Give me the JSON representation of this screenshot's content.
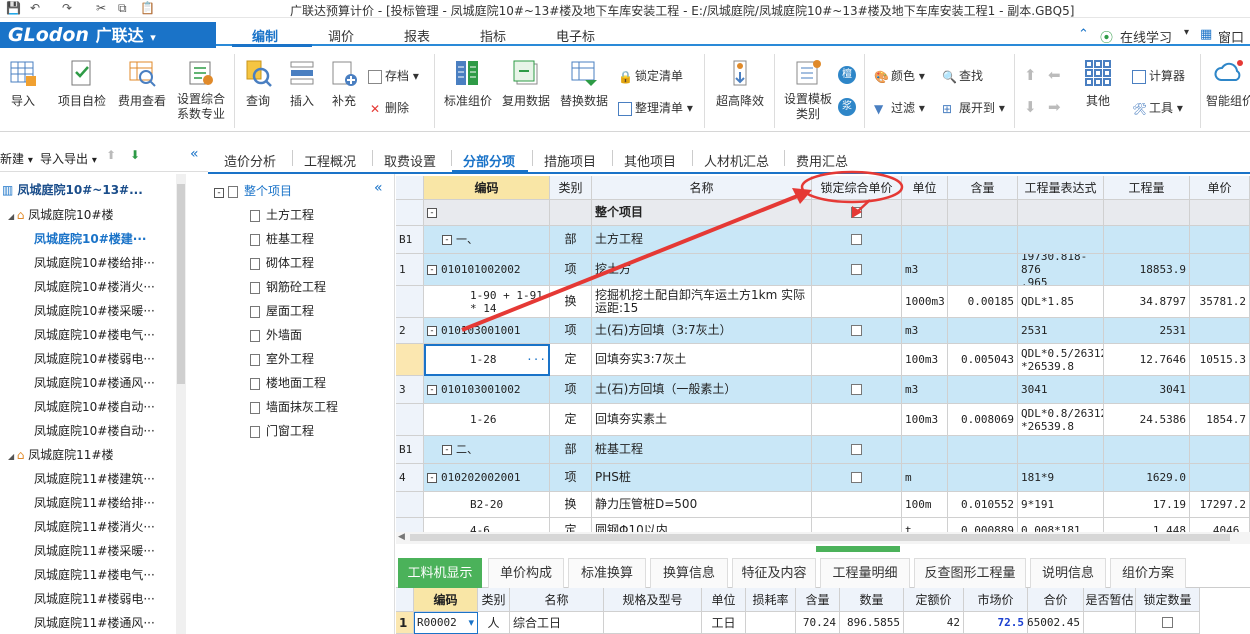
{
  "window": {
    "title": "广联达预算计价 - [投标管理 - 凤城庭院10#~13#楼及地下车库安装工程 - E:/凤城庭院/凤城庭院10#~13#楼及地下车库安装工程1 - 副本.GBQ5]"
  },
  "brand": {
    "logo": "GLodon",
    "logo_cn": "广联达",
    "dropdown": "▾"
  },
  "menu": {
    "items": [
      "编制",
      "调价",
      "报表",
      "指标",
      "电子标"
    ],
    "active": 0
  },
  "menu_right": {
    "online": "在线学习",
    "window": "窗口"
  },
  "ribbon": {
    "big": [
      "导入",
      "项目自检",
      "费用查看",
      "设置综合\n系数专业",
      "查询",
      "插入",
      "补充",
      "标准组价",
      "复用数据",
      "替换数据",
      "超高降效",
      "设置模板\n类别",
      "其他",
      "智能组价"
    ],
    "small": {
      "save": "存档",
      "delete": "删除",
      "lock_list": "锁定清单",
      "sort_list": "整理清单",
      "color": "颜色",
      "find": "查找",
      "filter": "过滤",
      "expand_to": "展开到",
      "calculator": "计算器",
      "tools": "工具"
    },
    "circle_icons": [
      "檀",
      "浆"
    ]
  },
  "left_toolbar": {
    "new": "新建",
    "import_export": "导入导出"
  },
  "left_tree": {
    "root": "凤城庭院10#~13#...",
    "items": [
      {
        "label": "凤城庭院10#楼",
        "level": 1
      },
      {
        "label": "凤城庭院10#楼建···",
        "level": 2,
        "selected": true
      },
      {
        "label": "凤城庭院10#楼给排···",
        "level": 2
      },
      {
        "label": "凤城庭院10#楼消火···",
        "level": 2
      },
      {
        "label": "凤城庭院10#楼采暖···",
        "level": 2
      },
      {
        "label": "凤城庭院10#楼电气···",
        "level": 2
      },
      {
        "label": "凤城庭院10#楼弱电···",
        "level": 2
      },
      {
        "label": "凤城庭院10#楼通风···",
        "level": 2
      },
      {
        "label": "凤城庭院10#楼自动···",
        "level": 2
      },
      {
        "label": "凤城庭院10#楼自动···",
        "level": 2
      },
      {
        "label": "凤城庭院11#楼",
        "level": 1
      },
      {
        "label": "凤城庭院11#楼建筑···",
        "level": 2
      },
      {
        "label": "凤城庭院11#楼给排···",
        "level": 2
      },
      {
        "label": "凤城庭院11#楼消火···",
        "level": 2
      },
      {
        "label": "凤城庭院11#楼采暖···",
        "level": 2
      },
      {
        "label": "凤城庭院11#楼电气···",
        "level": 2
      },
      {
        "label": "凤城庭院11#楼弱电···",
        "level": 2
      },
      {
        "label": "凤城庭院11#楼通风···",
        "level": 2
      }
    ]
  },
  "tabs": {
    "items": [
      "造价分析",
      "工程概况",
      "取费设置",
      "分部分项",
      "措施项目",
      "其他项目",
      "人材机汇总",
      "费用汇总"
    ],
    "active": 3
  },
  "section_tree": {
    "root": "整个项目",
    "items": [
      "土方工程",
      "桩基工程",
      "砌体工程",
      "钢筋砼工程",
      "屋面工程",
      "外墙面",
      "室外工程",
      "楼地面工程",
      "墙面抹灰工程",
      "门窗工程"
    ]
  },
  "grid": {
    "headers": [
      "",
      "编码",
      "类别",
      "名称",
      "锁定综合单价",
      "单位",
      "含量",
      "工程量表达式",
      "工程量",
      "单价"
    ],
    "rows": [
      {
        "no": "",
        "code": "",
        "type": "",
        "name": "整个项目",
        "unit": "",
        "content": "",
        "expr": "",
        "qty": "",
        "price": "",
        "style": "gray",
        "pm": "-",
        "chk": true
      },
      {
        "no": "B1",
        "code": "一、",
        "type": "部",
        "name": "土方工程",
        "unit": "",
        "content": "",
        "expr": "",
        "qty": "",
        "price": "",
        "style": "blue",
        "pm": "-",
        "chk": true
      },
      {
        "no": "1",
        "code": "010101002002",
        "type": "项",
        "name": "挖土方",
        "unit": "m3",
        "content": "",
        "expr": "19730.818-876\n.965",
        "qty": "18853.9",
        "price": "",
        "style": "blue",
        "pm": "-",
        "chk": true
      },
      {
        "no": "",
        "code": "1-90 + 1-91\n* 14",
        "type": "换",
        "name": "挖掘机挖土配自卸汽车运土方1km  实际\n运距:15",
        "unit": "1000m3",
        "content": "0.00185",
        "expr": "QDL*1.85",
        "qty": "34.8797",
        "price": "35781.2",
        "style": "white",
        "pm": "",
        "chk": false
      },
      {
        "no": "2",
        "code": "010103001001",
        "type": "项",
        "name": "土(石)方回填（3:7灰土）",
        "unit": "m3",
        "content": "",
        "expr": "2531",
        "qty": "2531",
        "price": "",
        "style": "blue",
        "pm": "-",
        "chk": true
      },
      {
        "no": "",
        "code": "1-28",
        "type": "定",
        "name": "回填夯实3:7灰土",
        "unit": "100m3",
        "content": "0.005043",
        "expr": "QDL*0.5/26312\n*26539.8",
        "qty": "12.7646",
        "price": "10515.3",
        "style": "white",
        "pm": "",
        "chk": false,
        "active": true
      },
      {
        "no": "3",
        "code": "010103001002",
        "type": "项",
        "name": "土(石)方回填（一般素土）",
        "unit": "m3",
        "content": "",
        "expr": "3041",
        "qty": "3041",
        "price": "",
        "style": "blue",
        "pm": "-",
        "chk": true
      },
      {
        "no": "",
        "code": "1-26",
        "type": "定",
        "name": "回填夯实素土",
        "unit": "100m3",
        "content": "0.008069",
        "expr": "QDL*0.8/26312\n*26539.8",
        "qty": "24.5386",
        "price": "1854.7",
        "style": "white",
        "pm": "",
        "chk": false
      },
      {
        "no": "B1",
        "code": "二、",
        "type": "部",
        "name": "桩基工程",
        "unit": "",
        "content": "",
        "expr": "",
        "qty": "",
        "price": "",
        "style": "blue",
        "pm": "-",
        "chk": true
      },
      {
        "no": "4",
        "code": "010202002001",
        "type": "项",
        "name": "PHS桩",
        "unit": "m",
        "content": "",
        "expr": "181*9",
        "qty": "1629.0",
        "price": "",
        "style": "blue",
        "pm": "-",
        "chk": true
      },
      {
        "no": "",
        "code": "B2-20",
        "type": "换",
        "name": "静力压管桩D=500",
        "unit": "100m",
        "content": "0.010552",
        "expr": "9*191",
        "qty": "17.19",
        "price": "17297.2",
        "style": "white",
        "pm": "",
        "chk": false
      },
      {
        "no": "",
        "code": "4-6",
        "type": "定",
        "name": "圆钢Φ10以内",
        "unit": "t",
        "content": "0.000889",
        "expr": "0.008*181",
        "qty": "1.448",
        "price": "4046.",
        "style": "white",
        "pm": "",
        "chk": false
      }
    ]
  },
  "bottom_tabs": {
    "items": [
      "工料机显示",
      "单价构成",
      "标准换算",
      "换算信息",
      "特征及内容",
      "工程量明细",
      "反查图形工程量",
      "说明信息",
      "组价方案"
    ],
    "active": 0
  },
  "bottom_grid": {
    "headers": [
      "",
      "编码",
      "类别",
      "名称",
      "规格及型号",
      "单位",
      "损耗率",
      "含量",
      "数量",
      "定额价",
      "市场价",
      "合价",
      "是否暂估",
      "锁定数量"
    ],
    "row": [
      "1",
      "R00002",
      "人",
      "综合工日",
      "",
      "工日",
      "",
      "70.24",
      "896.5855",
      "42",
      "72.5",
      "65002.45",
      "",
      ""
    ]
  },
  "colors": {
    "brand": "#1a73c8",
    "active_tab_green": "#4bb25a",
    "row_blue": "#c9e7f7",
    "annotation_red": "#e53935",
    "header_yellow": "#f9e6a6"
  }
}
